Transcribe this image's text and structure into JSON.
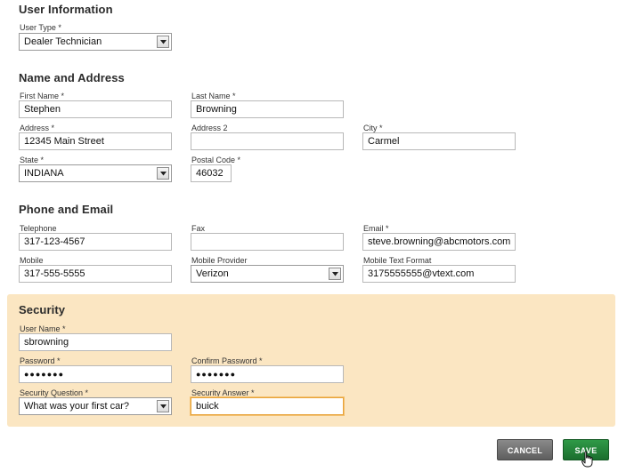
{
  "user_info": {
    "title": "User Information",
    "user_type_label": "User Type *",
    "user_type_value": "Dealer Technician"
  },
  "name_address": {
    "title": "Name and Address",
    "first_name_label": "First Name *",
    "first_name_value": "Stephen",
    "last_name_label": "Last Name *",
    "last_name_value": "Browning",
    "address_label": "Address *",
    "address_value": "12345 Main Street",
    "address2_label": "Address 2",
    "address2_value": "",
    "city_label": "City *",
    "city_value": "Carmel",
    "state_label": "State *",
    "state_value": "INDIANA",
    "postal_label": "Postal Code *",
    "postal_value": "46032"
  },
  "phone_email": {
    "title": "Phone and Email",
    "telephone_label": "Telephone",
    "telephone_value": "317-123-4567",
    "fax_label": "Fax",
    "fax_value": "",
    "email_label": "Email *",
    "email_value": "steve.browning@abcmotors.com",
    "mobile_label": "Mobile",
    "mobile_value": "317-555-5555",
    "provider_label": "Mobile Provider",
    "provider_value": "Verizon",
    "text_format_label": "Mobile Text Format",
    "text_format_value": "3175555555@vtext.com"
  },
  "security": {
    "title": "Security",
    "username_label": "User Name *",
    "username_value": "sbrowning",
    "password_label": "Password *",
    "password_value": "●●●●●●●",
    "confirm_label": "Confirm Password *",
    "confirm_value": "●●●●●●●",
    "question_label": "Security Question *",
    "question_value": "What was your first car?",
    "answer_label": "Security Answer *",
    "answer_value": "buick"
  },
  "actions": {
    "cancel_label": "CANCEL",
    "save_label": "SAVE"
  },
  "colors": {
    "security_bg": "#fbe6c2",
    "save_green": "#1f7a34",
    "cancel_gray": "#6e6e6e",
    "focus_orange": "#e8a33a"
  }
}
